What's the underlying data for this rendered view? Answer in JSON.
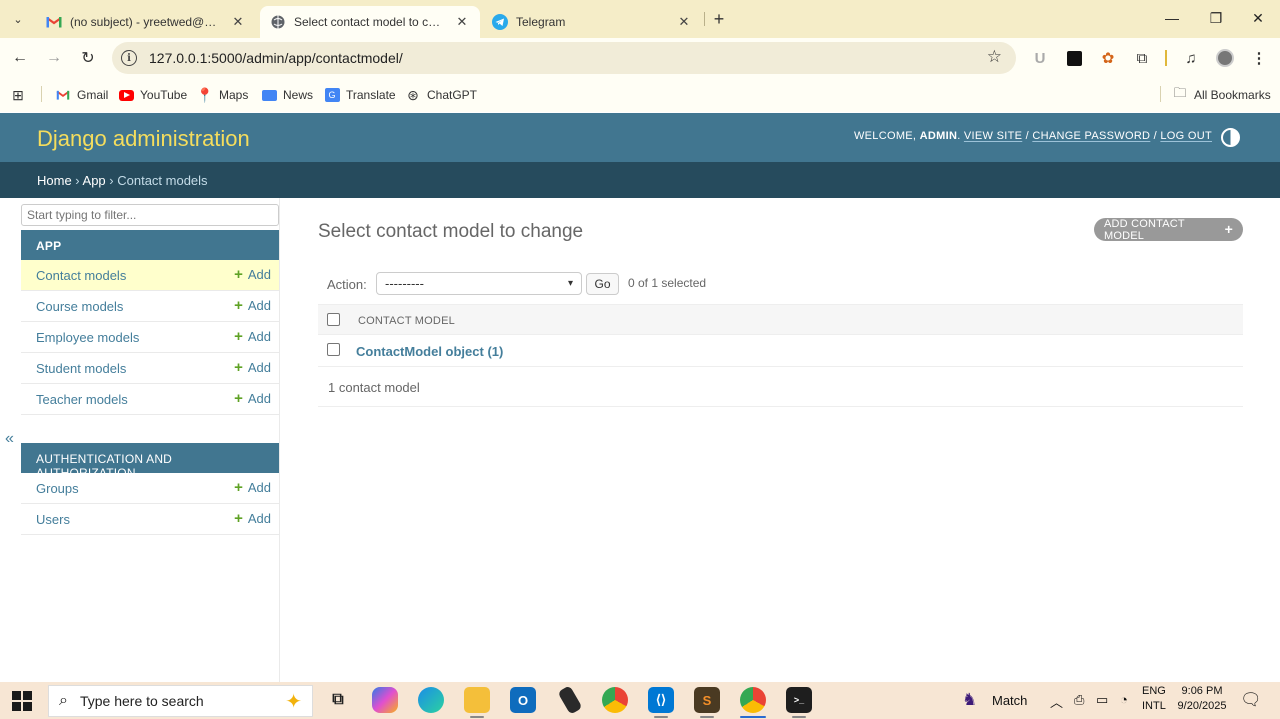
{
  "browser": {
    "tabs": [
      {
        "title": "(no subject) - yreetwed@gmail.",
        "icon": "gmail-icon"
      },
      {
        "title": "Select contact model to change",
        "icon": "django-globe-icon"
      },
      {
        "title": "Telegram",
        "icon": "telegram-icon"
      }
    ],
    "url": "127.0.0.1:5000/admin/app/contactmodel/",
    "bookmarks": [
      "Gmail",
      "YouTube",
      "Maps",
      "News",
      "Translate",
      "ChatGPT"
    ],
    "all_bookmarks": "All Bookmarks"
  },
  "admin": {
    "brand": "Django administration",
    "welcome": "WELCOME,",
    "user": "ADMIN",
    "view_site": "VIEW SITE",
    "change_password": "CHANGE PASSWORD",
    "log_out": "LOG OUT",
    "breadcrumb": {
      "home": "Home",
      "app": "App",
      "current": "Contact models"
    },
    "filter_placeholder": "Start typing to filter...",
    "apps": [
      {
        "caption": "APP",
        "models": [
          {
            "name": "Contact models",
            "add": "Add"
          },
          {
            "name": "Course models",
            "add": "Add"
          },
          {
            "name": "Employee models",
            "add": "Add"
          },
          {
            "name": "Student models",
            "add": "Add"
          },
          {
            "name": "Teacher models",
            "add": "Add"
          }
        ]
      },
      {
        "caption": "AUTHENTICATION AND AUTHORIZATION",
        "models": [
          {
            "name": "Groups",
            "add": "Add"
          },
          {
            "name": "Users",
            "add": "Add"
          }
        ]
      }
    ],
    "collapse": "«",
    "page_title": "Select contact model to change",
    "add_button": "ADD CONTACT MODEL",
    "action_label": "Action:",
    "action_value": "---------",
    "go": "Go",
    "selected_count": "0 of 1 selected",
    "column_header": "CONTACT MODEL",
    "rows": [
      "ContactModel object (1)"
    ],
    "result_count": "1 contact model"
  },
  "taskbar": {
    "search_placeholder": "Type here to search",
    "weather": "Match",
    "lang_top": "ENG",
    "lang_bottom": "INTL",
    "time": "9:06 PM",
    "date": "9/20/2025"
  },
  "colors": {
    "header": "#417690",
    "breadcrumbs": "#264b5d",
    "brand": "#f5dd5d",
    "link": "#447e9b",
    "current_row": "#ffffcc",
    "add_green": "#5fa225"
  }
}
